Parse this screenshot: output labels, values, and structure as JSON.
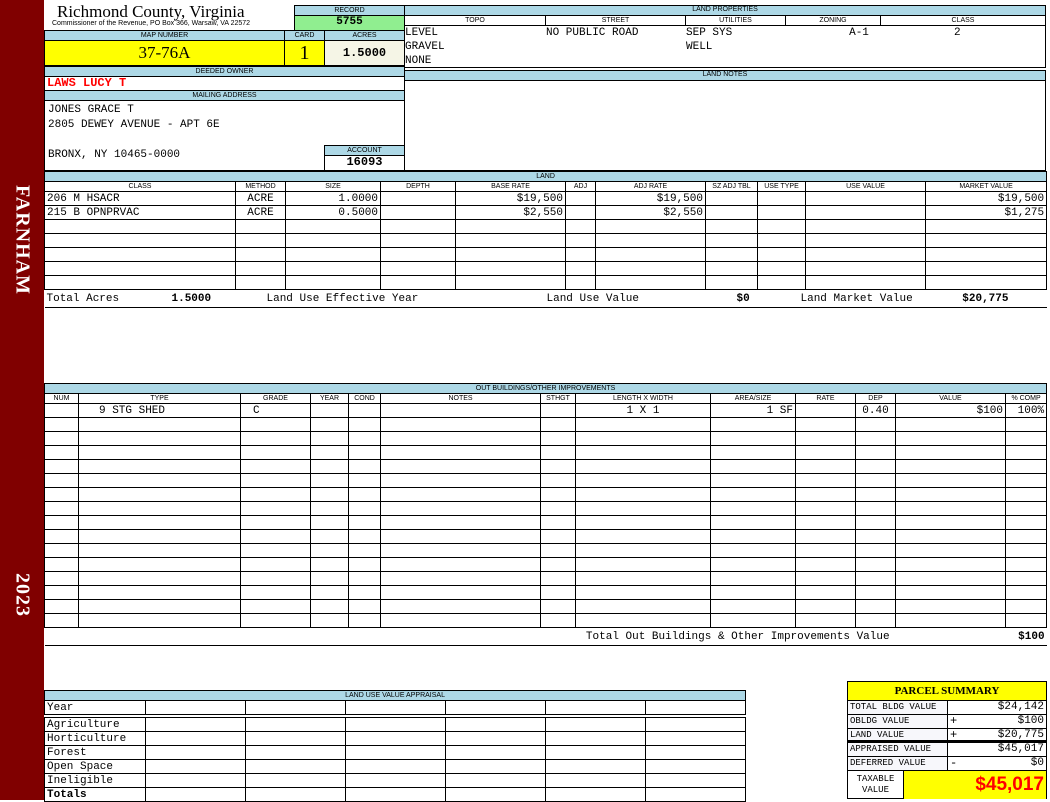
{
  "sidebar": {
    "district": "FARNHAM",
    "year": "2023"
  },
  "header": {
    "title": "Richmond County, Virginia",
    "subtitle": "Commissioner of the Revenue, PO Box 366, Warsaw, VA 22572"
  },
  "record": {
    "label": "RECORD",
    "value": "5755"
  },
  "map": {
    "map_label": "MAP NUMBER",
    "map_value": "37-76A",
    "card_label": "CARD",
    "card_value": "1",
    "acres_label": "ACRES",
    "acres_value": "1.5000"
  },
  "owner": {
    "label": "DEEDED OWNER",
    "name": "LAWS LUCY T"
  },
  "mailing": {
    "label": "MAILING ADDRESS",
    "lines": [
      "JONES GRACE T",
      "2805 DEWEY AVENUE - APT 6E",
      "",
      "BRONX, NY 10465-0000"
    ]
  },
  "account": {
    "label": "ACCOUNT",
    "value": "16093"
  },
  "land_properties": {
    "label": "LAND PROPERTIES",
    "headers": [
      "TOPO",
      "STREET",
      "UTILITIES",
      "ZONING",
      "CLASS"
    ],
    "topo": [
      "LEVEL",
      "GRAVEL",
      "NONE"
    ],
    "street": [
      "NO PUBLIC ROAD"
    ],
    "utilities": [
      "SEP SYS",
      "WELL"
    ],
    "zoning": [
      "A-1"
    ],
    "class": [
      "2"
    ]
  },
  "land_notes": {
    "label": "LAND NOTES"
  },
  "land": {
    "label": "LAND",
    "headers": [
      "CLASS",
      "METHOD",
      "SIZE",
      "DEPTH",
      "BASE RATE",
      "ADJ",
      "ADJ RATE",
      "SZ ADJ TBL",
      "USE TYPE",
      "USE VALUE",
      "MARKET VALUE"
    ],
    "rows": [
      [
        "206 M HSACR",
        "ACRE",
        "1.0000",
        "",
        "$19,500",
        "",
        "$19,500",
        "",
        "",
        "",
        "$19,500"
      ],
      [
        "215 B OPNPRVAC",
        "ACRE",
        "0.5000",
        "",
        "$2,550",
        "",
        "$2,550",
        "",
        "",
        "",
        "$1,275"
      ]
    ],
    "totals": {
      "acres_label": "Total Acres",
      "acres": "1.5000",
      "eff_year_label": "Land Use Effective Year",
      "eff_year": "",
      "use_value_label": "Land Use Value",
      "use_value": "$0",
      "market_label": "Land Market Value",
      "market": "$20,775"
    }
  },
  "outbuildings": {
    "label": "OUT BUILDINGS/OTHER IMPROVEMENTS",
    "headers": [
      "NUM",
      "TYPE",
      "GRADE",
      "YEAR",
      "COND",
      "NOTES",
      "STHGT",
      "LENGTH X WIDTH",
      "AREA/SIZE",
      "RATE",
      "DEP",
      "VALUE",
      "% COMP"
    ],
    "rows": [
      [
        "",
        "9 STG SHED",
        "C",
        "",
        "",
        "",
        "",
        "1 X 1",
        "1 SF",
        "",
        "0.40",
        "$100",
        "100%"
      ]
    ],
    "total_label": "Total Out Buildings & Other Improvements Value",
    "total": "$100"
  },
  "land_use": {
    "label": "LAND USE VALUE APPRAISAL",
    "year_label": "Year",
    "rows": [
      "Agriculture",
      "Horticulture",
      "Forest",
      "Open Space",
      "Ineligible"
    ],
    "totals_label": "Totals"
  },
  "summary": {
    "title": "PARCEL SUMMARY",
    "rows": [
      {
        "label": "TOTAL BLDG VALUE",
        "sign": "",
        "value": "$24,142"
      },
      {
        "label": "OBLDG VALUE",
        "sign": "+",
        "value": "$100"
      },
      {
        "label": "LAND VALUE",
        "sign": "+",
        "value": "$20,775"
      },
      {
        "label": "APPRAISED VALUE",
        "sign": "",
        "value": "$45,017"
      },
      {
        "label": "DEFERRED VALUE",
        "sign": "-",
        "value": "$0"
      }
    ],
    "taxable_label": "TAXABLE VALUE",
    "taxable": "$45,017"
  },
  "colors": {
    "sidebar": "#800000",
    "label_bar": "#add8e6",
    "record": "#90ee90",
    "highlight": "#ffff00",
    "owner": "#ff0000",
    "taxable": "#ff0000"
  }
}
